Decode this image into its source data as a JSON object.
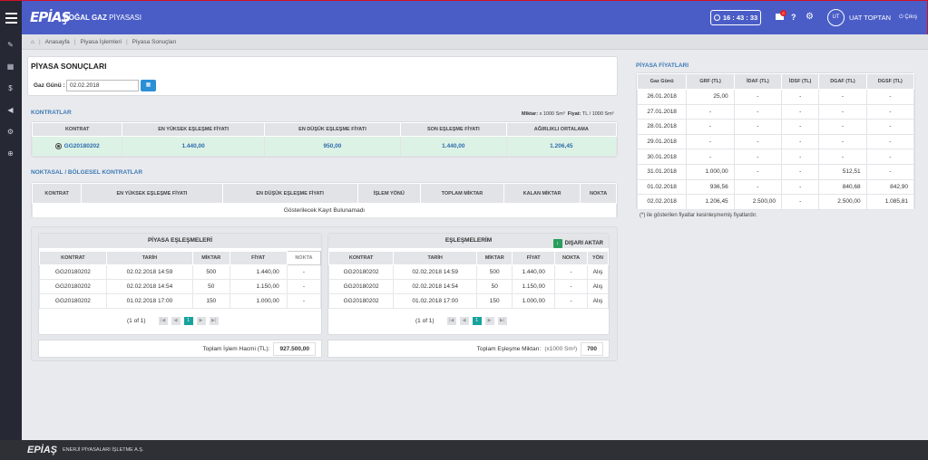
{
  "header": {
    "logo": "EPİAŞ",
    "title_bold": "DOĞAL GAZ",
    "title_rest": " PİYASASI",
    "clock": "16 : 43 : 33",
    "notification_count": "0",
    "help": "?",
    "avatar": "UT",
    "user": "UAT TOPTAN",
    "logout": "Çıkış"
  },
  "breadcrumb": {
    "home": "Anasayfa",
    "items": [
      "Piyasa İşlemleri",
      "Piyasa Sonuçları"
    ]
  },
  "page": {
    "title": "PİYASA SONUÇLARI",
    "gas_day_label": "Gaz Günü :",
    "gas_day_value": "02.02.2018"
  },
  "contracts": {
    "title": "KONTRATLAR",
    "unit_note_label1": "Miktar:",
    "unit_note_val1": "x 1000 Sm³",
    "unit_note_label2": "Fiyat:",
    "unit_note_val2": "TL / 1000 Sm³",
    "headers": [
      "KONTRAT",
      "EN YÜKSEK EŞLEŞME FİYATI",
      "EN DÜŞÜK EŞLEŞME FİYATI",
      "SON EŞLEŞME FİYATI",
      "AĞIRLIKLI ORTALAMA"
    ],
    "row": [
      "GG20180202",
      "1.440,00",
      "950,00",
      "1.440,00",
      "1.206,45"
    ]
  },
  "regional": {
    "title": "NOKTASAL / BÖLGESEL KONTRATLAR",
    "headers": [
      "KONTRAT",
      "EN YÜKSEK EŞLEŞME FİYATI",
      "EN DÜŞÜK EŞLEŞME FİYATI",
      "İŞLEM YÖNÜ",
      "TOPLAM MİKTAR",
      "KALAN MİKTAR",
      "NOKTA"
    ],
    "empty": "Gösterilecek Kayıt Bulunamadı"
  },
  "market_matches": {
    "title": "PİYASA EŞLEŞMELERİ",
    "headers": [
      "KONTRAT",
      "TARİH",
      "MİKTAR",
      "FİYAT",
      "NOKTA"
    ],
    "rows": [
      [
        "GG20180202",
        "02.02.2018 14:59",
        "500",
        "1.440,00",
        "-"
      ],
      [
        "GG20180202",
        "02.02.2018 14:54",
        "50",
        "1.150,00",
        "-"
      ],
      [
        "GG20180202",
        "01.02.2018 17:00",
        "150",
        "1.000,00",
        "-"
      ]
    ],
    "pager": "(1 of 1)",
    "page": "1",
    "total_label": "Toplam İşlem Hacmi (TL):",
    "total_value": "927.500,00"
  },
  "my_matches": {
    "title": "EŞLEŞMELERİM",
    "export_label": "DIŞARI AKTAR",
    "headers": [
      "KONTRAT",
      "TARİH",
      "MİKTAR",
      "FİYAT",
      "NOKTA",
      "YÖN"
    ],
    "rows": [
      [
        "GG20180202",
        "02.02.2018 14:59",
        "500",
        "1.440,00",
        "-",
        "Alış"
      ],
      [
        "GG20180202",
        "02.02.2018 14:54",
        "50",
        "1.150,00",
        "-",
        "Alış"
      ],
      [
        "GG20180202",
        "01.02.2018 17:00",
        "150",
        "1.000,00",
        "-",
        "Alış"
      ]
    ],
    "pager": "(1 of 1)",
    "page": "1",
    "total_label": "Toplam Eşleşme Miktarı:",
    "total_unit": "(x1000 Sm³)",
    "total_value": "700"
  },
  "prices": {
    "title": "PİYASA FİYATLARI",
    "headers": [
      "Gaz Günü",
      "GRF (TL)",
      "İDAF (TL)",
      "İDSF (TL)",
      "DGAF (TL)",
      "DGSF (TL)"
    ],
    "rows": [
      [
        "26.01.2018",
        "25,00",
        "-",
        "-",
        "-",
        "-"
      ],
      [
        "27.01.2018",
        "-",
        "-",
        "-",
        "-",
        "-"
      ],
      [
        "28.01.2018",
        "-",
        "-",
        "-",
        "-",
        "-"
      ],
      [
        "29.01.2018",
        "-",
        "-",
        "-",
        "-",
        "-"
      ],
      [
        "30.01.2018",
        "-",
        "-",
        "-",
        "-",
        "-"
      ],
      [
        "31.01.2018",
        "1.000,00",
        "-",
        "-",
        "512,51",
        "-"
      ],
      [
        "01.02.2018",
        "936,56",
        "-",
        "-",
        "840,68",
        "842,90"
      ],
      [
        "02.02.2018",
        "1.206,45",
        "2.500,00",
        "-",
        "2.500,00",
        "1.085,81"
      ]
    ],
    "note": "(*) ile gösterilen fiyatlar kesinleşmemiş fiyatlardır."
  },
  "footer": {
    "logo": "EPİAŞ",
    "company": "ENERJİ PİYASALARI İŞLETME A.Ş."
  },
  "icons": {
    "menu": "hamburger-icon",
    "clock": "clock-icon",
    "mail": "envelope-icon",
    "gear": "gear-icon",
    "home": "home-icon",
    "calendar": "calendar-icon",
    "excel": "excel-icon",
    "sidebar": [
      "edit-icon",
      "chart-icon",
      "coins-icon",
      "megaphone-icon",
      "settings-icon",
      "plus-circle-icon"
    ]
  },
  "colors": {
    "topbar": "#4a5dc7",
    "sidebar": "#262833",
    "accent": "#18a29e",
    "section": "#3d7bb5",
    "selected_row": "#dcf2e5"
  }
}
